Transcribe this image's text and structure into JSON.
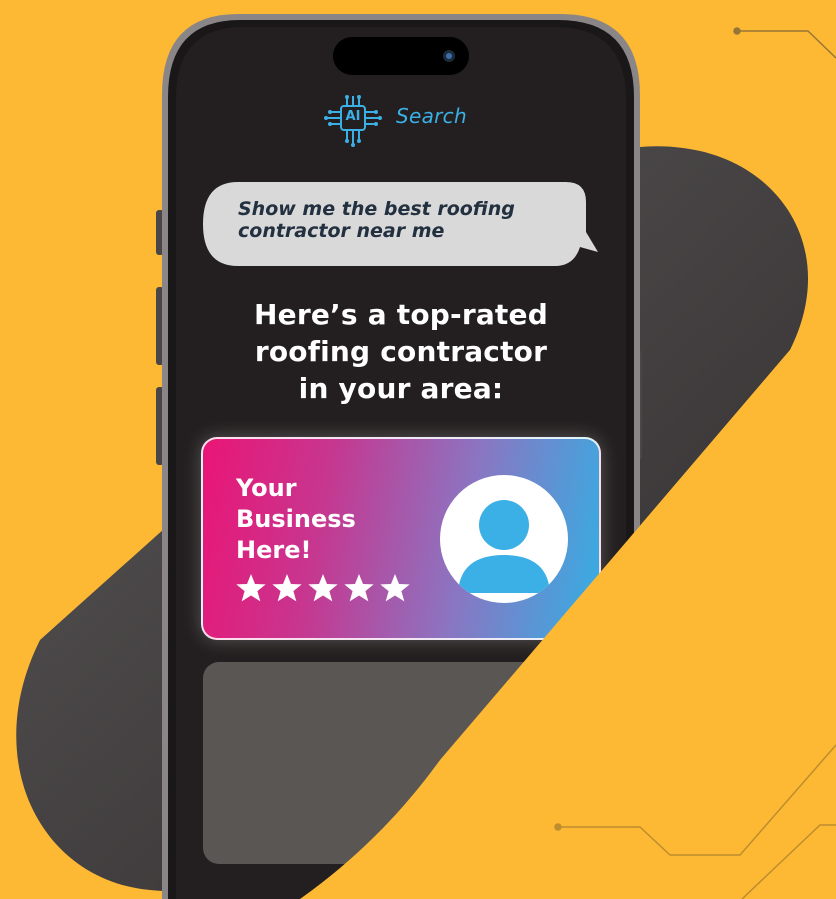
{
  "app": {
    "logo_chip_text": "AI",
    "logo_title": "Search"
  },
  "chat": {
    "user_query": "Show me the best roofing contractor near me"
  },
  "response": {
    "heading_lines": [
      "Here’s a top-rated",
      "roofing contractor",
      "in your area:"
    ]
  },
  "business_card": {
    "name_lines": [
      "Your",
      "Business",
      "Here!"
    ],
    "rating": 5,
    "max_rating": 5
  },
  "colors": {
    "background": "#fdb933",
    "phone_screen": "#231f20",
    "accent_blue": "#3ab0e6",
    "bubble": "#d9d9d9",
    "gradient_start": "#ea1576",
    "gradient_end": "#34aee3"
  },
  "icons": {
    "logo": "ai-chip-icon",
    "avatar": "user-avatar-icon",
    "rating": "star-icon"
  }
}
